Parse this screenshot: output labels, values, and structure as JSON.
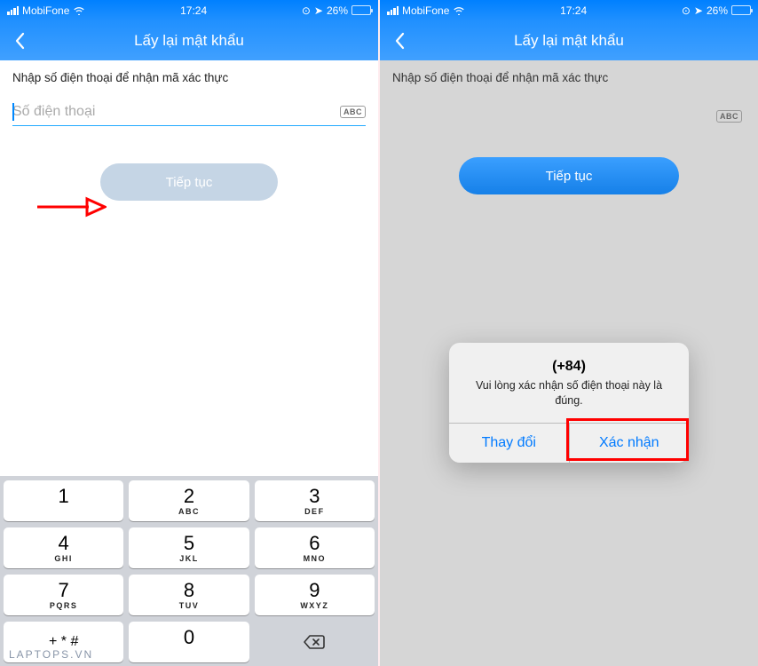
{
  "status": {
    "carrier": "MobiFone",
    "time": "17:24",
    "battery_percent": "26%"
  },
  "nav": {
    "title": "Lấy lại mật khẩu"
  },
  "screen": {
    "instruction": "Nhập số điện thoại để nhận mã xác thực",
    "phone_placeholder": "Số điện thoại",
    "abc_label": "ABC",
    "continue_label": "Tiếp tục"
  },
  "keypad": {
    "keys": [
      [
        {
          "num": "1",
          "letters": ""
        },
        {
          "num": "2",
          "letters": "ABC"
        },
        {
          "num": "3",
          "letters": "DEF"
        }
      ],
      [
        {
          "num": "4",
          "letters": "GHI"
        },
        {
          "num": "5",
          "letters": "JKL"
        },
        {
          "num": "6",
          "letters": "MNO"
        }
      ],
      [
        {
          "num": "7",
          "letters": "PQRS"
        },
        {
          "num": "8",
          "letters": "TUV"
        },
        {
          "num": "9",
          "letters": "WXYZ"
        }
      ],
      [
        {
          "special": "+ * #"
        },
        {
          "num": "0",
          "letters": ""
        },
        {
          "backspace": true
        }
      ]
    ]
  },
  "dialog": {
    "title": "(+84)",
    "message": "Vui lòng xác nhận số điện thoại này là đúng.",
    "change_label": "Thay đổi",
    "confirm_label": "Xác nhận"
  },
  "watermark": "LAPTOPS.VN"
}
